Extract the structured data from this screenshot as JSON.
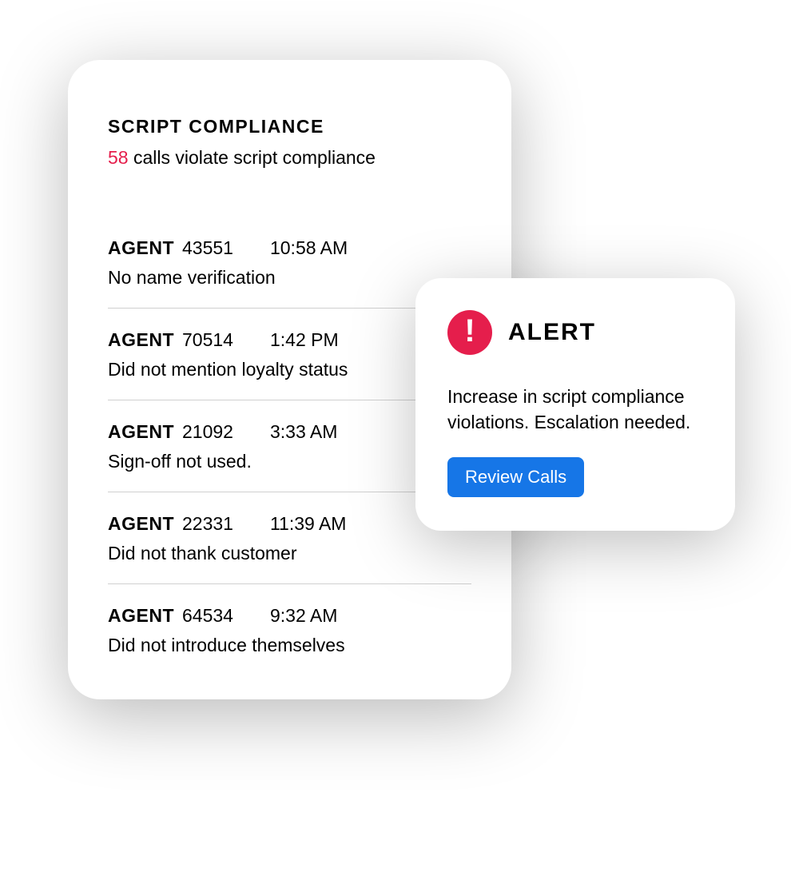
{
  "compliance": {
    "title": "SCRIPT COMPLIANCE",
    "count": "58",
    "subtitle_tail": " calls violate script compliance",
    "agent_label": "AGENT",
    "rows": [
      {
        "id": "43551",
        "time": "10:58 AM",
        "violation": "No name verification"
      },
      {
        "id": "70514",
        "time": "1:42 PM",
        "violation": "Did not mention loyalty status"
      },
      {
        "id": "21092",
        "time": "3:33 AM",
        "violation": "Sign-off not used."
      },
      {
        "id": "22331",
        "time": "11:39 AM",
        "violation": "Did not thank customer"
      },
      {
        "id": "64534",
        "time": "9:32 AM",
        "violation": "Did not introduce themselves"
      }
    ]
  },
  "alert": {
    "title": "ALERT",
    "body": "Increase in script compliance violations. Escalation needed.",
    "button_label": "Review Calls"
  },
  "colors": {
    "accent_red": "#e51e4c",
    "primary_blue": "#1676e7"
  }
}
